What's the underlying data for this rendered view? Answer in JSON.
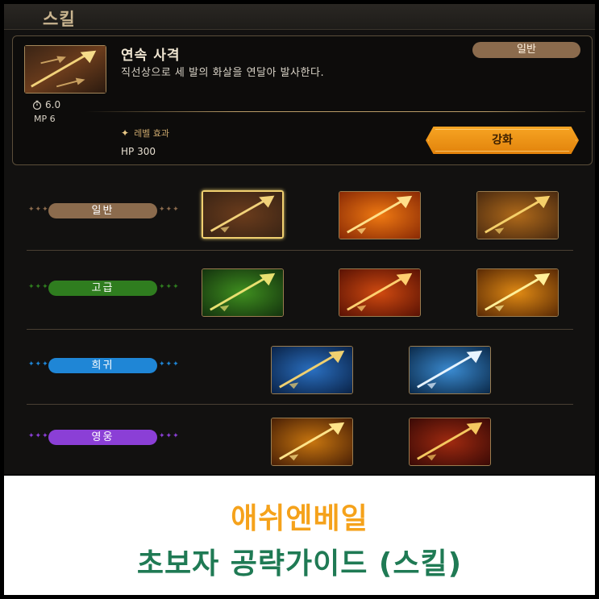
{
  "header": {
    "title": "스킬"
  },
  "detail": {
    "name": "연속 사격",
    "description": "직선상으로 세 발의 화살을 연달아 발사한다.",
    "rarity": "일반",
    "cooldown": "6.0",
    "mp": "MP 6",
    "level_effect_label": "레벨 효과",
    "level_effect_value": "HP 300",
    "enhance_label": "강화",
    "icon": "triple-arrow-icon"
  },
  "tiers": [
    {
      "label": "일반",
      "color": "#8b6b4d",
      "skills": [
        {
          "icon": "triple-arrow-icon",
          "selected": true
        },
        {
          "icon": "fire-arrow-icon"
        },
        {
          "icon": "split-arrow-icon"
        }
      ]
    },
    {
      "label": "고급",
      "color": "#2f7d1f",
      "skills": [
        {
          "icon": "wind-arrow-icon"
        },
        {
          "icon": "explosive-arrow-icon"
        },
        {
          "icon": "lightning-arrow-icon"
        }
      ]
    },
    {
      "label": "희귀",
      "color": "#1f86d6",
      "skills": [
        {
          "icon": "arrow-rain-icon"
        },
        {
          "icon": "frost-arrow-icon"
        }
      ]
    },
    {
      "label": "영웅",
      "color": "#8b3fd6",
      "skills": [
        {
          "icon": "golden-bow-icon"
        },
        {
          "icon": "radial-arrows-icon"
        }
      ]
    }
  ],
  "caption": {
    "line1": "애쉬엔베일",
    "line2": "초보자 공략가이드 (스킬)"
  }
}
